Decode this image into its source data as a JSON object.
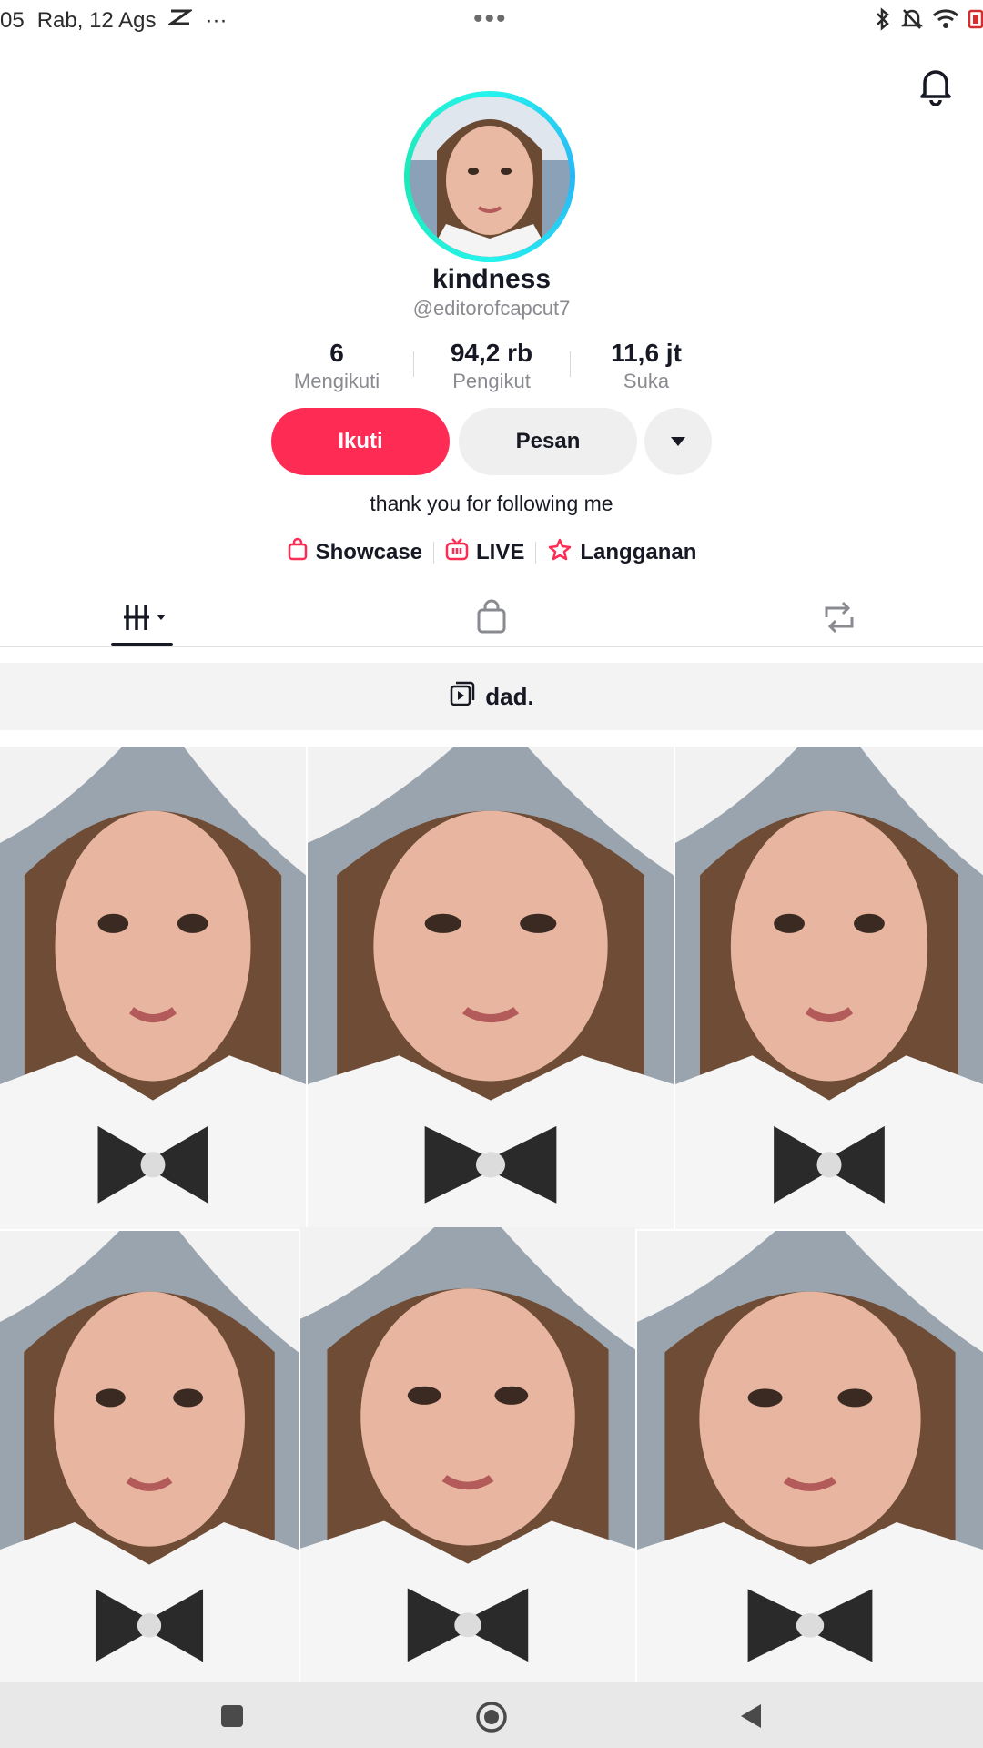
{
  "status_bar": {
    "time": "05",
    "date": "Rab, 12 Ags",
    "center_dots": "•••",
    "more": "···"
  },
  "profile": {
    "display_name": "kindness",
    "handle": "@editorofcapcut7",
    "bio": "thank you for following me"
  },
  "stats": [
    {
      "value": "6",
      "label": "Mengikuti"
    },
    {
      "value": "94,2 rb",
      "label": "Pengikut"
    },
    {
      "value": "11,6 jt",
      "label": "Suka"
    }
  ],
  "actions": {
    "follow_label": "Ikuti",
    "message_label": "Pesan"
  },
  "links": [
    {
      "icon": "shopping-bag-icon",
      "label": "Showcase"
    },
    {
      "icon": "live-tv-icon",
      "label": "LIVE"
    },
    {
      "icon": "subscription-star-icon",
      "label": "Langganan"
    }
  ],
  "tabs": [
    {
      "icon": "videos-grid-icon",
      "active": true
    },
    {
      "icon": "shopping-bag-icon",
      "active": false
    },
    {
      "icon": "repost-icon",
      "active": false
    }
  ],
  "playlist": {
    "icon": "playlist-icon",
    "label": "dad."
  },
  "video_tiles": [
    {
      "index": 1
    },
    {
      "index": 2
    },
    {
      "index": 3
    },
    {
      "index": 4
    },
    {
      "index": 5
    },
    {
      "index": 6
    }
  ],
  "colors": {
    "accent": "#fe2c55",
    "avatar_ring": "#25f4ee",
    "text": "#161823",
    "muted": "#8a8b91"
  }
}
